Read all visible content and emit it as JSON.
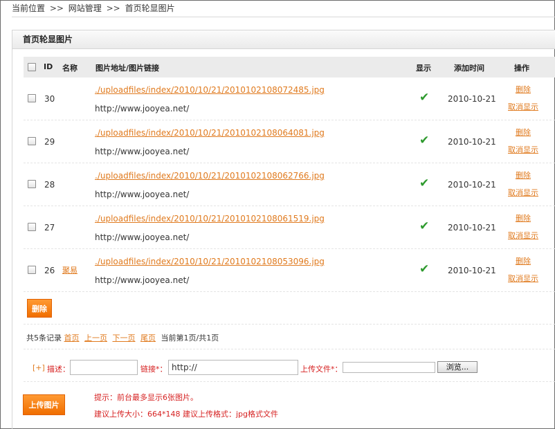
{
  "breadcrumb": {
    "items": [
      "当前位置",
      "网站管理",
      "首页轮显图片"
    ],
    "sep": ">>"
  },
  "panel": {
    "title": "首页轮显图片"
  },
  "table": {
    "headers": {
      "id": "ID",
      "name": "名称",
      "url": "图片地址/图片链接",
      "show": "显示",
      "time": "添加时间",
      "ops": "操作"
    },
    "rows": [
      {
        "id": "30",
        "name": "",
        "path": "./uploadfiles/index/2010/10/21/2010102108072485.jpg",
        "link": "http://www.jooyea.net/",
        "shown": "✔",
        "date": "2010-10-21",
        "act1": "删除",
        "act2": "取消显示"
      },
      {
        "id": "29",
        "name": "",
        "path": "./uploadfiles/index/2010/10/21/2010102108064081.jpg",
        "link": "http://www.jooyea.net/",
        "shown": "✔",
        "date": "2010-10-21",
        "act1": "删除",
        "act2": "取消显示"
      },
      {
        "id": "28",
        "name": "",
        "path": "./uploadfiles/index/2010/10/21/2010102108062766.jpg",
        "link": "http://www.jooyea.net/",
        "shown": "✔",
        "date": "2010-10-21",
        "act1": "删除",
        "act2": "取消显示"
      },
      {
        "id": "27",
        "name": "",
        "path": "./uploadfiles/index/2010/10/21/2010102108061519.jpg",
        "link": "http://www.jooyea.net/",
        "shown": "✔",
        "date": "2010-10-21",
        "act1": "删除",
        "act2": "取消显示"
      },
      {
        "id": "26",
        "name": "聚易",
        "path": "./uploadfiles/index/2010/10/21/2010102108053096.jpg",
        "link": "http://www.jooyea.net/",
        "shown": "✔",
        "date": "2010-10-21",
        "act1": "删除",
        "act2": "取消显示"
      }
    ]
  },
  "delete_button": "删除",
  "pager": {
    "summary": "共5条记录",
    "first": "首页",
    "prev": "上一页",
    "next": "下一页",
    "last": "尾页",
    "status": "当前第1页/共1页"
  },
  "form": {
    "plus": "[+]",
    "desc_label": "描述：",
    "desc_value": "",
    "link_label": "链接*：",
    "link_value": "http://",
    "file_label": "上传文件*：",
    "browse_label": "浏览..."
  },
  "upload_button": "上传图片",
  "tips": [
    "提示：前台最多显示6张图片。",
    "建议上传大小：664*148 建议上传格式：jpg格式文件"
  ]
}
